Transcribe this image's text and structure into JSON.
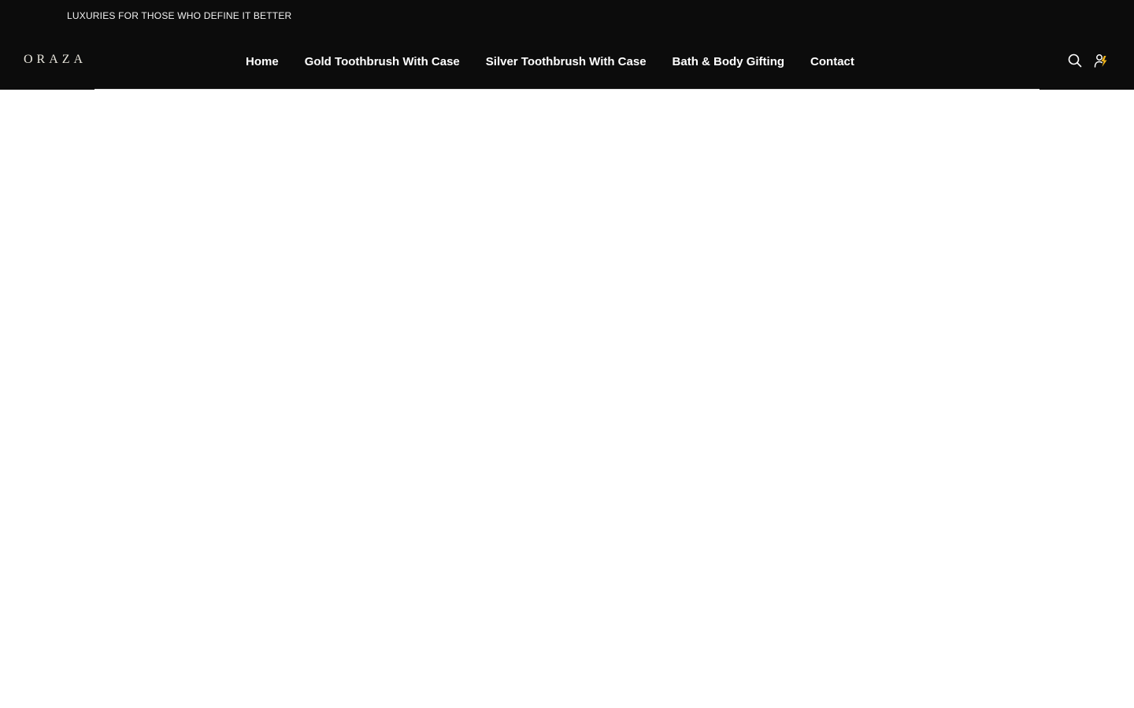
{
  "announcement": {
    "text": "LUXURIES FOR THOSE WHO DEFINE IT BETTER"
  },
  "header": {
    "logo": "ORAZA",
    "nav": [
      {
        "label": "Home"
      },
      {
        "label": "Gold Toothbrush With Case"
      },
      {
        "label": "Silver Toothbrush With Case"
      },
      {
        "label": "Bath & Body Gifting"
      },
      {
        "label": "Contact"
      }
    ],
    "icons": {
      "search": "search-icon",
      "account": "account-icon"
    }
  },
  "colors": {
    "header_bg": "#0c0c0c",
    "nav_text": "#ffffff",
    "accent": "#f2b51a",
    "page_bg": "#ffffff"
  }
}
